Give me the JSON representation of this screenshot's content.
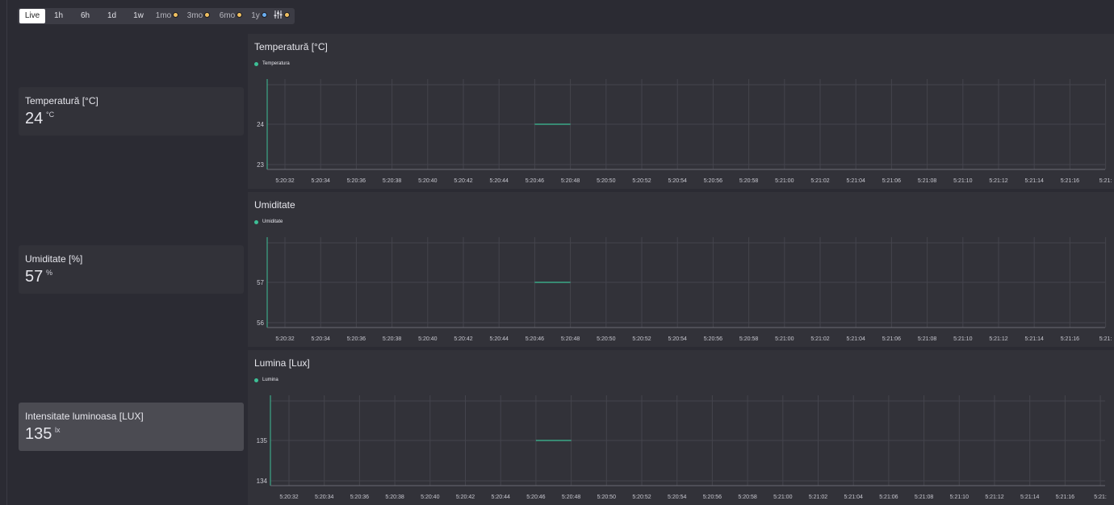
{
  "time_range": {
    "buttons": [
      {
        "label": "Live",
        "active": true
      },
      {
        "label": "1h"
      },
      {
        "label": "6h"
      },
      {
        "label": "1d"
      },
      {
        "label": "1w"
      },
      {
        "label": "1mo",
        "dot": "#f0c060"
      },
      {
        "label": "3mo",
        "dot": "#f0c060"
      },
      {
        "label": "6mo",
        "dot": "#f0c060"
      },
      {
        "label": "1y",
        "dot": "#6aaef0"
      }
    ],
    "settings_dot": "#f0c060",
    "settings_icon": "sliders-icon"
  },
  "cards": [
    {
      "title": "Temperatură [°C]",
      "value": "24",
      "unit": "°C"
    },
    {
      "title": "Umiditate [%]",
      "value": "57",
      "unit": "%"
    },
    {
      "title": "Intensitate luminoasa [LUX]",
      "value": "135",
      "unit": "lx"
    }
  ],
  "charts": [
    {
      "title": "Temperatură [°C]",
      "legend": "Temperatura"
    },
    {
      "title": "Umiditate",
      "legend": "Umiditate"
    },
    {
      "title": "Lumina [Lux]",
      "legend": "Lumina"
    }
  ],
  "chart_data": [
    {
      "type": "line",
      "title": "Temperatură [°C]",
      "x": [
        "5:20:32",
        "5:20:34",
        "5:20:36",
        "5:20:38",
        "5:20:40",
        "5:20:42",
        "5:20:44",
        "5:20:46",
        "5:20:48",
        "5:20:50",
        "5:20:52",
        "5:20:54",
        "5:20:56",
        "5:20:58",
        "5:21:00",
        "5:21:02",
        "5:21:04",
        "5:21:06",
        "5:21:08",
        "5:21:10",
        "5:21:12",
        "5:21:14",
        "5:21:16",
        "5:21:"
      ],
      "yticks": [
        23,
        24
      ],
      "series": [
        {
          "name": "Temperatura",
          "color": "#3dbf96",
          "points": [
            {
              "x": "5:20:46",
              "y": 24
            },
            {
              "x": "5:20:48",
              "y": 24
            }
          ]
        }
      ]
    },
    {
      "type": "line",
      "title": "Umiditate",
      "x": [
        "5:20:32",
        "5:20:34",
        "5:20:36",
        "5:20:38",
        "5:20:40",
        "5:20:42",
        "5:20:44",
        "5:20:46",
        "5:20:48",
        "5:20:50",
        "5:20:52",
        "5:20:54",
        "5:20:56",
        "5:20:58",
        "5:21:00",
        "5:21:02",
        "5:21:04",
        "5:21:06",
        "5:21:08",
        "5:21:10",
        "5:21:12",
        "5:21:14",
        "5:21:16",
        "5:21:"
      ],
      "yticks": [
        56,
        57
      ],
      "series": [
        {
          "name": "Umiditate",
          "color": "#3dbf96",
          "points": [
            {
              "x": "5:20:46",
              "y": 57
            },
            {
              "x": "5:20:48",
              "y": 57
            }
          ]
        }
      ]
    },
    {
      "type": "line",
      "title": "Lumina [Lux]",
      "x": [
        "5:20:32",
        "5:20:34",
        "5:20:36",
        "5:20:38",
        "5:20:40",
        "5:20:42",
        "5:20:44",
        "5:20:46",
        "5:20:48",
        "5:20:50",
        "5:20:52",
        "5:20:54",
        "5:20:56",
        "5:20:58",
        "5:21:00",
        "5:21:02",
        "5:21:04",
        "5:21:06",
        "5:21:08",
        "5:21:10",
        "5:21:12",
        "5:21:14",
        "5:21:16",
        "5:21:"
      ],
      "yticks": [
        134,
        135
      ],
      "series": [
        {
          "name": "Lumina",
          "color": "#3dbf96",
          "points": [
            {
              "x": "5:20:46",
              "y": 135
            },
            {
              "x": "5:20:48",
              "y": 135
            }
          ]
        }
      ]
    }
  ]
}
